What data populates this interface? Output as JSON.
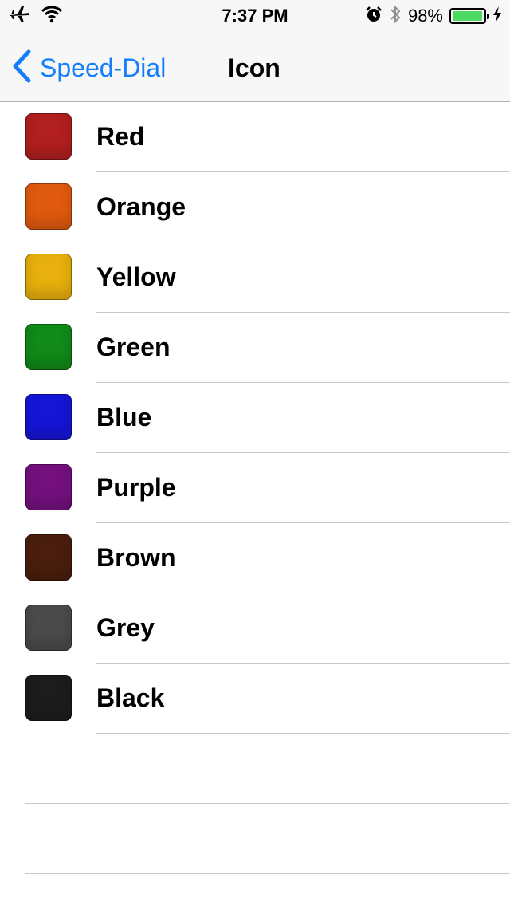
{
  "status_bar": {
    "time": "7:37 PM",
    "battery_percent": "98%",
    "battery_level": 0.98,
    "icons": [
      "airplane-icon",
      "wifi-icon",
      "alarm-icon",
      "bluetooth-icon",
      "battery-icon",
      "charging-bolt-icon"
    ]
  },
  "nav": {
    "back_label": "Speed-Dial",
    "title": "Icon",
    "accent": "#157efb"
  },
  "colors": [
    {
      "label": "Red",
      "color": "#b21f1f"
    },
    {
      "label": "Orange",
      "color": "#e05a0e"
    },
    {
      "label": "Yellow",
      "color": "#e8b00c"
    },
    {
      "label": "Green",
      "color": "#118a18"
    },
    {
      "label": "Blue",
      "color": "#1515d6"
    },
    {
      "label": "Purple",
      "color": "#74107e"
    },
    {
      "label": "Brown",
      "color": "#4a1e0c"
    },
    {
      "label": "Grey",
      "color": "#4a4a4a"
    },
    {
      "label": "Black",
      "color": "#1c1c1c"
    }
  ]
}
